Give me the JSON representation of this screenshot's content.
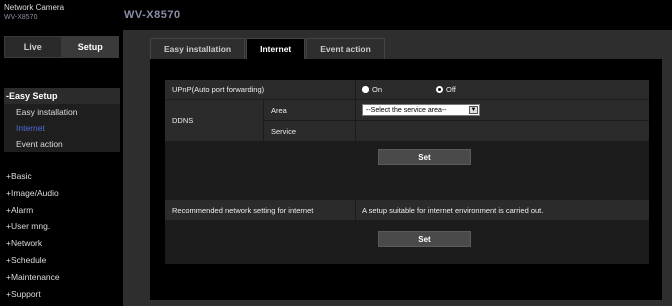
{
  "header": {
    "brand": "Network Camera",
    "model_small": "WV-X8570",
    "model_big": "WV-X8570"
  },
  "sidebar": {
    "tabs": [
      {
        "label": "Live",
        "active": false
      },
      {
        "label": "Setup",
        "active": true
      }
    ],
    "section_title": "-Easy Setup",
    "sub_items": [
      {
        "label": "Easy installation",
        "active": false
      },
      {
        "label": "Internet",
        "active": true
      },
      {
        "label": "Event action",
        "active": false
      }
    ],
    "menu_items": [
      {
        "label": "+Basic"
      },
      {
        "label": "+Image/Audio"
      },
      {
        "label": "+Alarm"
      },
      {
        "label": "+User mng."
      },
      {
        "label": "+Network"
      },
      {
        "label": "+Schedule"
      },
      {
        "label": "+Maintenance"
      },
      {
        "label": "+Support"
      }
    ]
  },
  "tabs": [
    {
      "label": "Easy installation",
      "active": false
    },
    {
      "label": "Internet",
      "active": true
    },
    {
      "label": "Event action",
      "active": false
    }
  ],
  "form": {
    "upnp": {
      "label": "UPnP(Auto port forwarding)",
      "option_on": "On",
      "option_off": "Off",
      "selected": "On"
    },
    "ddns": {
      "label": "DDNS",
      "area_label": "Area",
      "area_value": "--Select the service area--",
      "service_label": "Service",
      "service_value": ""
    },
    "set_button_1": "Set",
    "recommended": {
      "label": "Recommended network setting for internet",
      "description": "A setup suitable for internet environment is carried out."
    },
    "set_button_2": "Set"
  },
  "colors": {
    "accent_link": "#4f6bd8",
    "background": "#000000",
    "panel": "#2b2b2b"
  }
}
